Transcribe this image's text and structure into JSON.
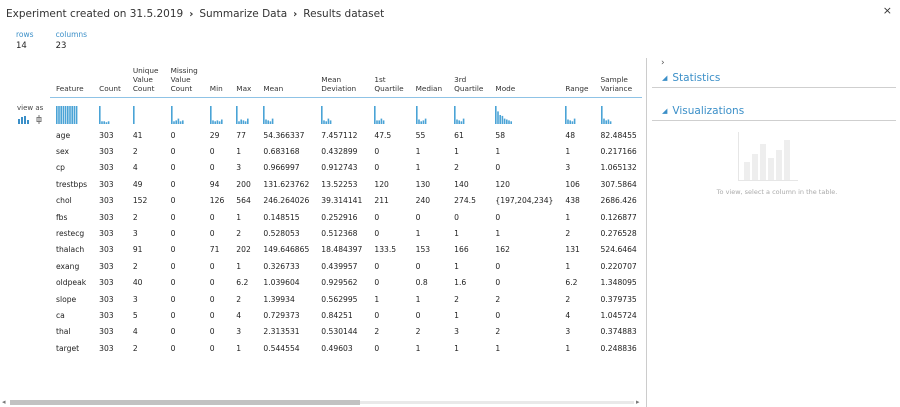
{
  "breadcrumb": {
    "items": [
      "Experiment created on 31.5.2019",
      "Summarize Data",
      "Results dataset"
    ],
    "separator": "›"
  },
  "close_label": "×",
  "counts": {
    "rows_label": "rows",
    "rows_value": "14",
    "columns_label": "columns",
    "columns_value": "23"
  },
  "view_as_label": "view as",
  "table": {
    "columns": [
      "Feature",
      "Count",
      "Unique Value Count",
      "Missing Value Count",
      "Min",
      "Max",
      "Mean",
      "Mean Deviation",
      "1st Quartile",
      "Median",
      "3rd Quartile",
      "Mode",
      "Range",
      "Sample Variance"
    ],
    "rows": [
      [
        "age",
        "303",
        "41",
        "0",
        "29",
        "77",
        "54.366337",
        "7.457112",
        "47.5",
        "55",
        "61",
        "58",
        "48",
        "82.48455"
      ],
      [
        "sex",
        "303",
        "2",
        "0",
        "0",
        "1",
        "0.683168",
        "0.432899",
        "0",
        "1",
        "1",
        "1",
        "1",
        "0.217166"
      ],
      [
        "cp",
        "303",
        "4",
        "0",
        "0",
        "3",
        "0.966997",
        "0.912743",
        "0",
        "1",
        "2",
        "0",
        "3",
        "1.065132"
      ],
      [
        "trestbps",
        "303",
        "49",
        "0",
        "94",
        "200",
        "131.623762",
        "13.52253",
        "120",
        "130",
        "140",
        "120",
        "106",
        "307.5864"
      ],
      [
        "chol",
        "303",
        "152",
        "0",
        "126",
        "564",
        "246.264026",
        "39.314141",
        "211",
        "240",
        "274.5",
        "{197,204,234}",
        "438",
        "2686.426"
      ],
      [
        "fbs",
        "303",
        "2",
        "0",
        "0",
        "1",
        "0.148515",
        "0.252916",
        "0",
        "0",
        "0",
        "0",
        "1",
        "0.126877"
      ],
      [
        "restecg",
        "303",
        "3",
        "0",
        "0",
        "2",
        "0.528053",
        "0.512368",
        "0",
        "1",
        "1",
        "1",
        "2",
        "0.276528"
      ],
      [
        "thalach",
        "303",
        "91",
        "0",
        "71",
        "202",
        "149.646865",
        "18.484397",
        "133.5",
        "153",
        "166",
        "162",
        "131",
        "524.6464"
      ],
      [
        "exang",
        "303",
        "2",
        "0",
        "0",
        "1",
        "0.326733",
        "0.439957",
        "0",
        "0",
        "1",
        "0",
        "1",
        "0.220707"
      ],
      [
        "oldpeak",
        "303",
        "40",
        "0",
        "0",
        "6.2",
        "1.039604",
        "0.929562",
        "0",
        "0.8",
        "1.6",
        "0",
        "6.2",
        "1.348095"
      ],
      [
        "slope",
        "303",
        "3",
        "0",
        "0",
        "2",
        "1.39934",
        "0.562995",
        "1",
        "1",
        "2",
        "2",
        "2",
        "0.379735"
      ],
      [
        "ca",
        "303",
        "5",
        "0",
        "0",
        "4",
        "0.729373",
        "0.84251",
        "0",
        "0",
        "1",
        "0",
        "4",
        "1.045724"
      ],
      [
        "thal",
        "303",
        "4",
        "0",
        "0",
        "3",
        "2.313531",
        "0.530144",
        "2",
        "2",
        "3",
        "2",
        "3",
        "0.374883"
      ],
      [
        "target",
        "303",
        "2",
        "0",
        "0",
        "1",
        "0.544554",
        "0.49603",
        "0",
        "1",
        "1",
        "1",
        "1",
        "0.248836"
      ]
    ]
  },
  "right_panel": {
    "statistics_title": "Statistics",
    "visualizations_title": "Visualizations",
    "visualizations_message": "To view, select a column in the table."
  },
  "colors": {
    "accent": "#3b8fc8",
    "bar": "#4aa3d6"
  }
}
